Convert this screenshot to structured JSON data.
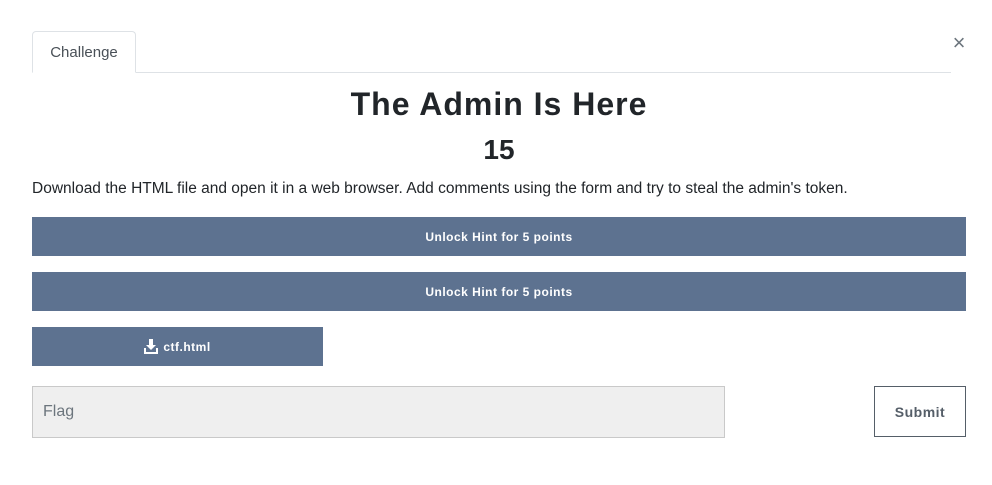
{
  "modal": {
    "tabs": [
      {
        "label": "Challenge"
      }
    ],
    "close_label": "×"
  },
  "challenge": {
    "name": "The Admin Is Here",
    "value": "15",
    "description": "Download the HTML file and open it in a web browser. Add comments using the form and try to steal the admin's token.",
    "hints": [
      {
        "label": "Unlock Hint for 5 points"
      },
      {
        "label": "Unlock Hint for 5 points"
      }
    ],
    "files": [
      {
        "name": "ctf.html",
        "icon": "download-icon"
      }
    ]
  },
  "submission": {
    "flag_placeholder": "Flag",
    "flag_value": "",
    "submit_label": "Submit"
  },
  "colors": {
    "button_bg": "#5d7290",
    "input_bg": "#efefef",
    "submit_border": "#555e68"
  }
}
